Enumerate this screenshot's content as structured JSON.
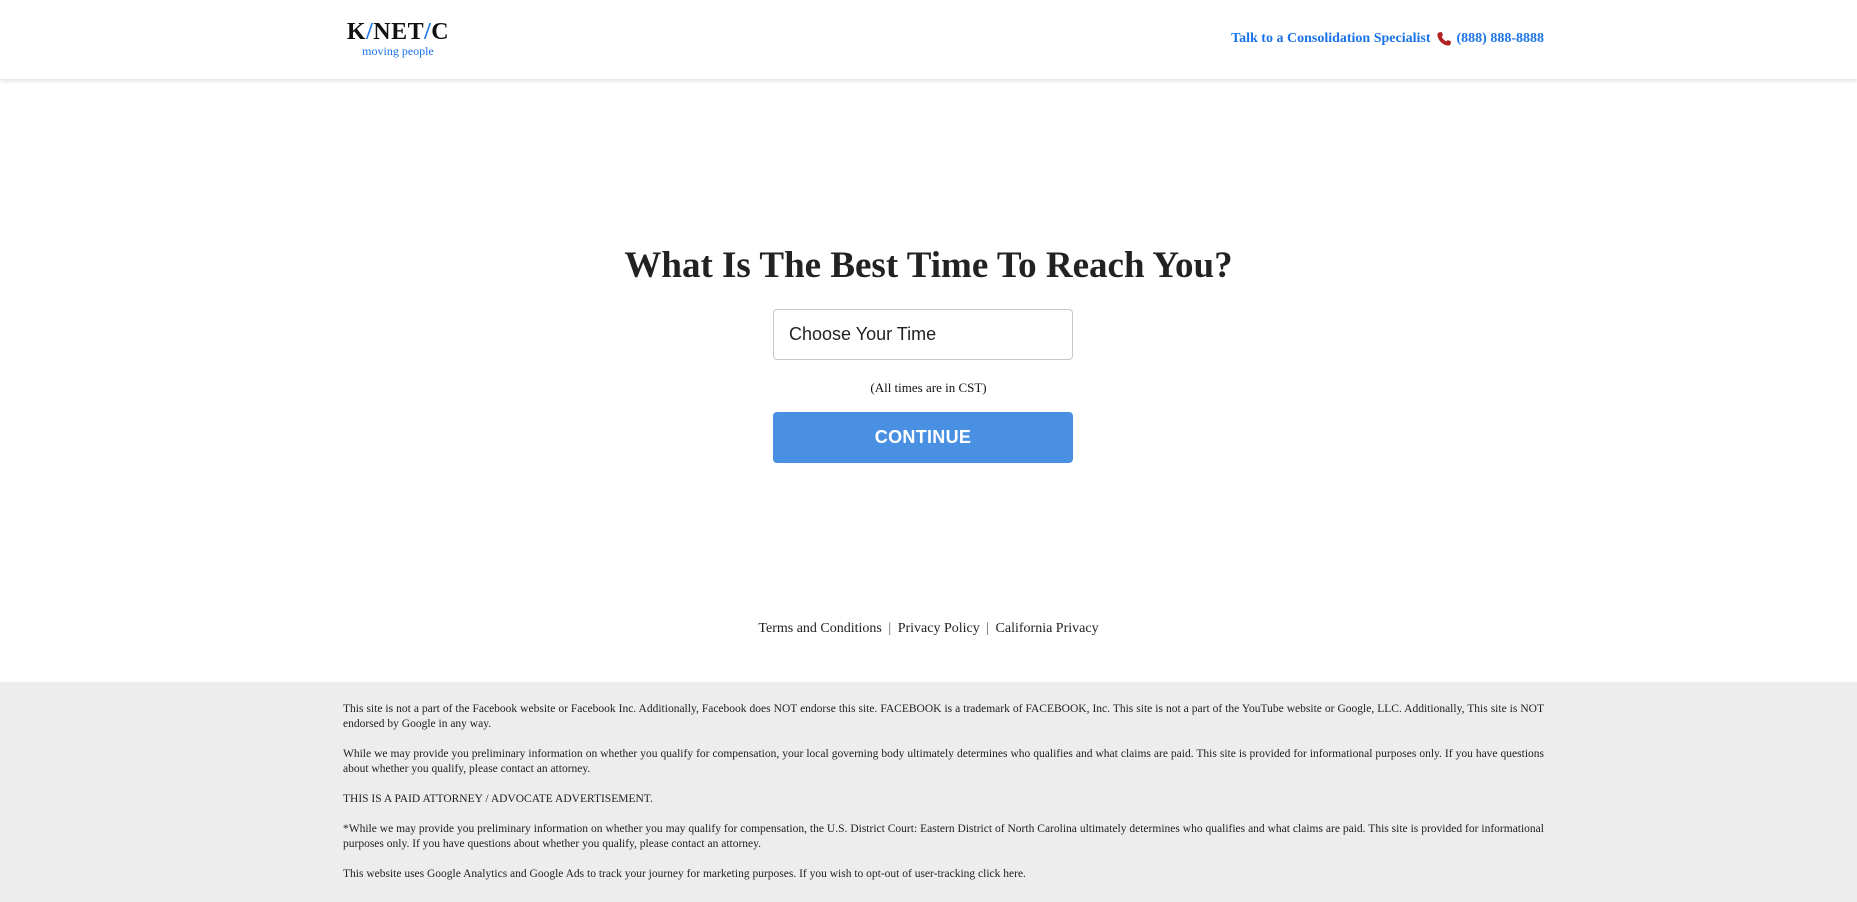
{
  "header": {
    "logo": {
      "k": "K",
      "slash1": "/",
      "net": "NET",
      "slash2": "/",
      "c": "C",
      "tagline": "moving people"
    },
    "contact_text": "Talk to a Consolidation Specialist",
    "phone_icon": "phone-icon",
    "phone_number": "(888) 888-8888"
  },
  "main": {
    "question": "What Is The Best Time To Reach You?",
    "time_select": {
      "value": "Choose Your Time"
    },
    "timezone_note": "(All times are in CST)",
    "continue_label": "CONTINUE"
  },
  "footer_links": {
    "terms": "Terms and Conditions",
    "sep1": "|",
    "privacy": "Privacy Policy",
    "sep2": "|",
    "california": "California Privacy"
  },
  "disclaimer": {
    "p1": "This site is not a part of the Facebook website or Facebook Inc. Additionally, Facebook does NOT endorse this site. FACEBOOK is a trademark of FACEBOOK, Inc. This site is not a part of the YouTube website or Google, LLC. Additionally, This site is NOT endorsed by Google in any way.",
    "p2": "While we may provide you preliminary information on whether you qualify for compensation, your local governing body ultimately determines who qualifies and what claims are paid. This site is provided for informational purposes only. If you have questions about whether you qualify, please contact an attorney.",
    "p3": "THIS IS A PAID ATTORNEY / ADVOCATE ADVERTISEMENT.",
    "p4": "*While we may provide you preliminary information on whether you may qualify for compensation, the U.S. District Court: Eastern District of North Carolina ultimately determines who qualifies and what claims are paid. This site is provided for informational purposes only. If you have questions about whether you qualify, please contact an attorney.",
    "p5_text": "This website uses Google Analytics and Google Ads to track your journey for marketing purposes. If you wish to opt-out of user-tracking ",
    "p5_link": "click here."
  },
  "colors": {
    "accent": "#1a73e8",
    "button": "#4a90e2",
    "disclaimer_bg": "#ededed",
    "phone_icon": "#b22222"
  }
}
